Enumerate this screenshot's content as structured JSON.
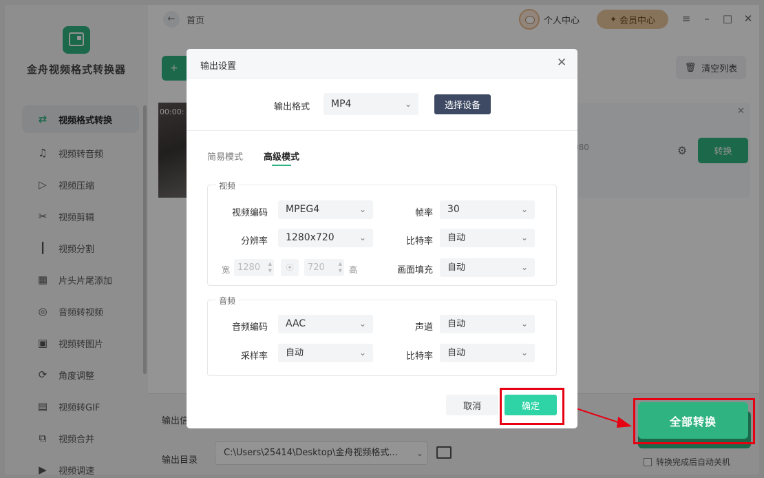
{
  "app": {
    "title": "金舟视频格式转换器"
  },
  "sidebar": {
    "items": [
      {
        "label": "视频格式转换",
        "icon": "convert-icon",
        "active": true
      },
      {
        "label": "视频转音频",
        "icon": "music-icon"
      },
      {
        "label": "视频压缩",
        "icon": "compress-icon"
      },
      {
        "label": "视频剪辑",
        "icon": "scissors-icon"
      },
      {
        "label": "视频分割",
        "icon": "split-icon"
      },
      {
        "label": "片头片尾添加",
        "icon": "film-icon"
      },
      {
        "label": "音频转视频",
        "icon": "disc-icon"
      },
      {
        "label": "视频转图片",
        "icon": "image-icon"
      },
      {
        "label": "角度调整",
        "icon": "rotate-icon"
      },
      {
        "label": "视频转GIF",
        "icon": "gif-icon"
      },
      {
        "label": "视频合并",
        "icon": "merge-icon"
      },
      {
        "label": "视频调速",
        "icon": "speed-icon"
      }
    ]
  },
  "topbar": {
    "breadcrumb": "首页",
    "user_center": "个人中心",
    "vip_center": "会员中心"
  },
  "main": {
    "add_button": "+",
    "clear_list": "清空列表",
    "file": {
      "time": "00:00:",
      "meta": "080",
      "convert_label": "转换"
    },
    "bottom": {
      "output_label_partial": "输出信",
      "output_dir_label": "输出目录",
      "output_dir_value": "C:\\Users\\25414\\Desktop\\金舟视频格式...",
      "convert_all": "全部转换",
      "auto_shutdown": "转换完成后自动关机"
    }
  },
  "modal": {
    "title": "输出设置",
    "format_label": "输出格式",
    "format_value": "MP4",
    "device_button": "选择设备",
    "tabs": [
      {
        "label": "简易模式",
        "active": false
      },
      {
        "label": "高级模式",
        "active": true
      }
    ],
    "video": {
      "legend": "视频",
      "codec_label": "视频编码",
      "codec_value": "MPEG4",
      "fps_label": "帧率",
      "fps_value": "30",
      "resolution_label": "分辨率",
      "resolution_value": "1280x720",
      "bitrate_label": "比特率",
      "bitrate_value": "自动",
      "width_label": "宽",
      "width_value": "1280",
      "height_label": "高",
      "height_value": "720",
      "fill_label": "画面填充",
      "fill_value": "自动"
    },
    "audio": {
      "legend": "音频",
      "codec_label": "音频编码",
      "codec_value": "AAC",
      "channel_label": "声道",
      "channel_value": "自动",
      "samplerate_label": "采样率",
      "samplerate_value": "自动",
      "bitrate_label": "比特率",
      "bitrate_value": "自动"
    },
    "cancel": "取消",
    "confirm": "确定"
  },
  "colors": {
    "accent": "#2fb380",
    "confirm": "#2ed3a6",
    "device_button": "#3e4a63",
    "highlight_box": "#e60012"
  }
}
